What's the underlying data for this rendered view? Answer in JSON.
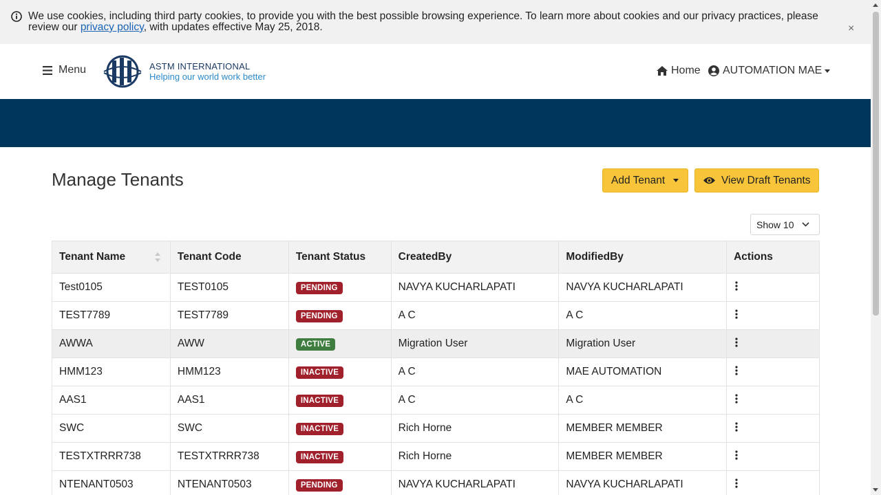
{
  "cookie_banner": {
    "text_before": "We use cookies, including third party cookies, to provide you with the best possible browsing experience. To learn more about cookies and our privacy practices, please review our ",
    "link_text": "privacy policy",
    "text_after": ", with updates effective May 25, 2018.",
    "close_label": "×"
  },
  "header": {
    "menu_label": "Menu",
    "logo_line1": "ASTM INTERNATIONAL",
    "logo_line2": "Helping our world work better",
    "home_label": "Home",
    "user_label": "AUTOMATION MAE"
  },
  "page": {
    "title": "Manage Tenants",
    "add_tenant_label": "Add Tenant",
    "view_draft_label": "View Draft Tenants",
    "show_label": "Show 10"
  },
  "table": {
    "columns": [
      "Tenant Name",
      "Tenant Code",
      "Tenant Status",
      "CreatedBy",
      "ModifiedBy",
      "Actions"
    ],
    "rows": [
      {
        "name": "Test0105",
        "code": "TEST0105",
        "status": "PENDING",
        "created": "NAVYA KUCHARLAPATI",
        "modified": "NAVYA KUCHARLAPATI"
      },
      {
        "name": "TEST7789",
        "code": "TEST7789",
        "status": "PENDING",
        "created": "A C",
        "modified": "A C"
      },
      {
        "name": "AWWA",
        "code": "AWW",
        "status": "ACTIVE",
        "created": "Migration User",
        "modified": "Migration User"
      },
      {
        "name": "HMM123",
        "code": "HMM123",
        "status": "INACTIVE",
        "created": "A C",
        "modified": "MAE AUTOMATION"
      },
      {
        "name": "AAS1",
        "code": "AAS1",
        "status": "INACTIVE",
        "created": "A C",
        "modified": "A C"
      },
      {
        "name": "SWC",
        "code": "SWC",
        "status": "INACTIVE",
        "created": "Rich Horne",
        "modified": "MEMBER MEMBER"
      },
      {
        "name": "TESTXTRRR738",
        "code": "TESTXTRRR738",
        "status": "INACTIVE",
        "created": "Rich Horne",
        "modified": "MEMBER MEMBER"
      },
      {
        "name": "NTENANT0503",
        "code": "NTENANT0503",
        "status": "PENDING",
        "created": "NAVYA KUCHARLAPATI",
        "modified": "NAVYA KUCHARLAPATI"
      }
    ]
  },
  "colors": {
    "banner": "#00355c",
    "button": "#f8c53a",
    "badge_pending": "#a0202b",
    "badge_active": "#3f7c3f"
  }
}
